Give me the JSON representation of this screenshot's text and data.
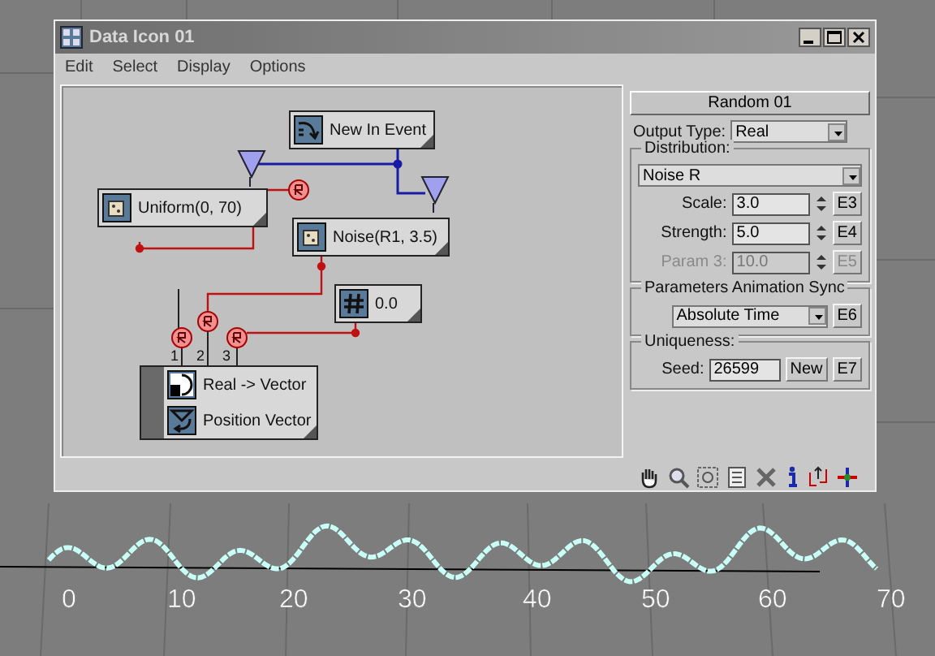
{
  "window": {
    "title": "Data Icon 01"
  },
  "menu": [
    "Edit",
    "Select",
    "Display",
    "Options"
  ],
  "graph": {
    "nodes": [
      {
        "kind": "event",
        "label": "New In Event"
      },
      {
        "kind": "random",
        "label": "Uniform(0, 70)"
      },
      {
        "kind": "random",
        "label": "Noise(R1, 3.5)"
      },
      {
        "kind": "scalar",
        "label": "0.0"
      },
      {
        "kind": "converter",
        "label": "Real -> Vector",
        "sub_label": "Position Vector",
        "ports": [
          "1",
          "2",
          "3"
        ]
      }
    ]
  },
  "panel": {
    "title": "Random 01",
    "output_type": {
      "label": "Output Type:",
      "value": "Real"
    },
    "distribution": {
      "label": "Distribution:",
      "value": "Noise R",
      "params": [
        {
          "label": "Scale:",
          "value": "3.0",
          "key": "E3",
          "disabled": false
        },
        {
          "label": "Strength:",
          "value": "5.0",
          "key": "E4",
          "disabled": false
        },
        {
          "label": "Param 3:",
          "value": "10.0",
          "key": "E5",
          "disabled": true
        }
      ]
    },
    "sync": {
      "label": "Parameters Animation Sync",
      "value": "Absolute Time",
      "key": "E6"
    },
    "uniqueness": {
      "label": "Uniqueness:",
      "seed_label": "Seed:",
      "seed": "26599",
      "button": "New",
      "key": "E7"
    }
  },
  "viewport": {
    "axis_labels": [
      "0",
      "10",
      "20",
      "30",
      "40",
      "50",
      "60",
      "70"
    ]
  }
}
